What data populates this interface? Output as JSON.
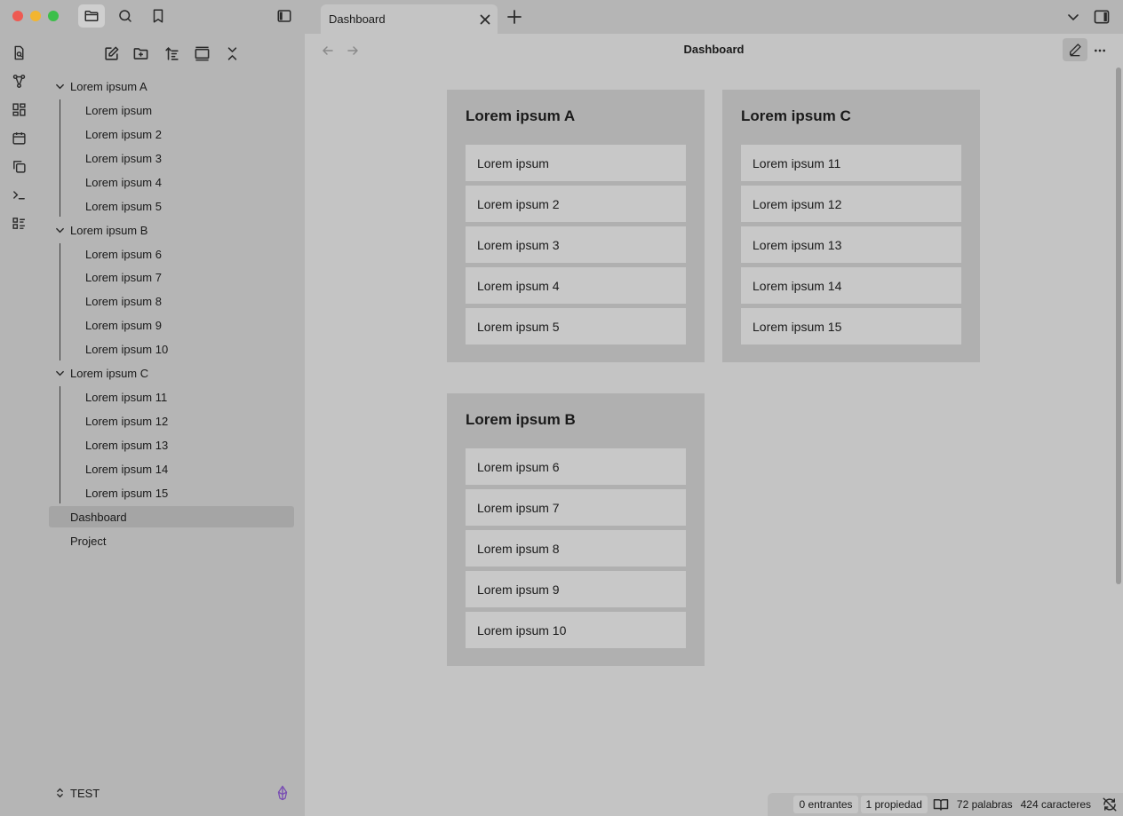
{
  "window": {
    "active_tab": "Dashboard"
  },
  "icons": {
    "files": "folder-icon",
    "search": "search-icon",
    "bookmarks": "bookmark-icon",
    "sidebar_toggle": "sidebar-toggle-icon"
  },
  "sidebar": {
    "folders": [
      {
        "label": "Lorem ipsum A",
        "items": [
          "Lorem ipsum",
          "Lorem ipsum 2",
          "Lorem ipsum 3",
          "Lorem ipsum 4",
          "Lorem ipsum 5"
        ]
      },
      {
        "label": "Lorem ipsum B",
        "items": [
          "Lorem ipsum 6",
          "Lorem ipsum 7",
          "Lorem ipsum 8",
          "Lorem ipsum 9",
          "Lorem ipsum 10"
        ]
      },
      {
        "label": "Lorem ipsum C",
        "items": [
          "Lorem ipsum 11",
          "Lorem ipsum 12",
          "Lorem ipsum 13",
          "Lorem ipsum 14",
          "Lorem ipsum 15"
        ]
      }
    ],
    "files": [
      "Dashboard",
      "Project"
    ],
    "vault_name": "TEST"
  },
  "view": {
    "title": "Dashboard"
  },
  "cards": [
    {
      "title": "Lorem ipsum A",
      "items": [
        "Lorem ipsum",
        "Lorem ipsum 2",
        "Lorem ipsum 3",
        "Lorem ipsum 4",
        "Lorem ipsum 5"
      ]
    },
    {
      "title": "Lorem ipsum C",
      "items": [
        "Lorem ipsum 11",
        "Lorem ipsum 12",
        "Lorem ipsum 13",
        "Lorem ipsum 14",
        "Lorem ipsum 15"
      ]
    },
    {
      "title": "Lorem ipsum B",
      "items": [
        "Lorem ipsum 6",
        "Lorem ipsum 7",
        "Lorem ipsum 8",
        "Lorem ipsum 9",
        "Lorem ipsum 10"
      ]
    }
  ],
  "status": {
    "backlinks": "0 entrantes",
    "properties": "1 propiedad",
    "words": "72 palabras",
    "chars": "424 caracteres"
  }
}
